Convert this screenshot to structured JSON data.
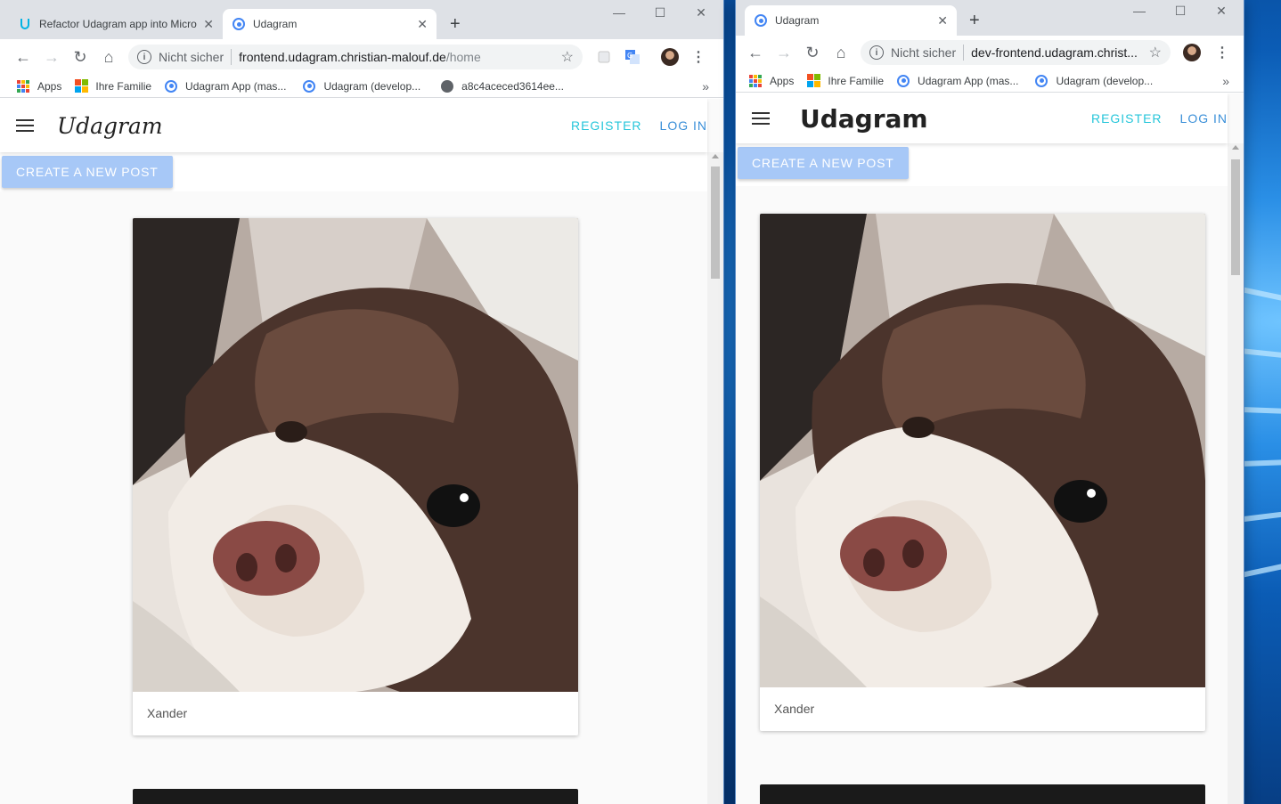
{
  "left_window": {
    "tabs": [
      {
        "title": "Refactor Udagram app into Micro",
        "active": false,
        "icon": "udacity-icon"
      },
      {
        "title": "Udagram",
        "active": true,
        "icon": "chrome-page-icon"
      }
    ],
    "address": {
      "security": "Nicht sicher",
      "host": "frontend.udagram.christian-malouf.de",
      "path": "/home"
    },
    "bookmarks": [
      {
        "label": "Apps",
        "icon": "apps-grid-icon"
      },
      {
        "label": "Ihre Familie",
        "icon": "microsoft-logo-icon"
      },
      {
        "label": "Udagram App (mas...",
        "icon": "chrome-page-icon"
      },
      {
        "label": "Udagram (develop...",
        "icon": "chrome-page-icon"
      },
      {
        "label": "a8c4aceced3614ee...",
        "icon": "globe-icon"
      }
    ],
    "bookmarks_more": "»",
    "app": {
      "brand": "Udagram",
      "register": "REGISTER",
      "login": "LOG IN",
      "create_post": "CREATE A NEW POST"
    },
    "posts": [
      {
        "caption": "Xander"
      }
    ]
  },
  "right_window": {
    "tabs": [
      {
        "title": "Udagram",
        "active": true,
        "icon": "chrome-page-icon"
      }
    ],
    "address": {
      "security": "Nicht sicher",
      "host": "dev-frontend.udagram.christ...",
      "path": ""
    },
    "bookmarks": [
      {
        "label": "Apps",
        "icon": "apps-grid-icon"
      },
      {
        "label": "Ihre Familie",
        "icon": "microsoft-logo-icon"
      },
      {
        "label": "Udagram App (mas...",
        "icon": "chrome-page-icon"
      },
      {
        "label": "Udagram (develop...",
        "icon": "chrome-page-icon"
      }
    ],
    "bookmarks_more": "»",
    "app": {
      "brand": "Udagram",
      "register": "REGISTER",
      "login": "LOG IN",
      "create_post": "CREATE A NEW POST"
    },
    "posts": [
      {
        "caption": "Xander"
      }
    ]
  },
  "glyphs": {
    "close": "✕",
    "new_tab": "+",
    "back": "←",
    "forward": "→",
    "reload": "↻",
    "home": "⌂",
    "star": "☆",
    "menu": "⋮",
    "minimize": "—",
    "maximize": "☐"
  }
}
